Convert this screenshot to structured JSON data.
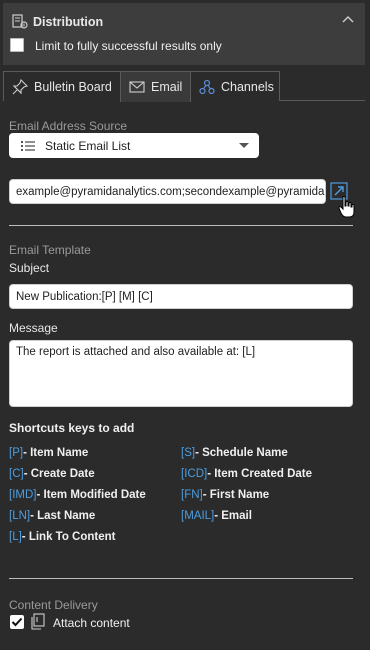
{
  "panel": {
    "title": "Distribution",
    "checkbox_label": "Limit to fully successful results only",
    "checkbox_checked": false
  },
  "tabs": [
    {
      "label": "Bulletin Board",
      "icon": "pin-icon",
      "active": false
    },
    {
      "label": "Email",
      "icon": "envelope-icon",
      "active": true
    },
    {
      "label": "Channels",
      "icon": "channels-icon",
      "active": false
    }
  ],
  "email_source": {
    "section_label": "Email Address Source",
    "selected": "Static Email List",
    "address_value": "example@pyramidanalytics.com;secondexample@pyramidanalytics.com"
  },
  "template": {
    "section_label": "Email Template",
    "subject_label": "Subject",
    "subject_value": "New Publication:[P] [M] [C]",
    "message_label": "Message",
    "message_value": "The report is attached and also available at: [L]"
  },
  "shortcuts": {
    "title": "Shortcuts keys to add",
    "items": [
      {
        "key": "[P]",
        "label": "- Item Name"
      },
      {
        "key": "[S]",
        "label": "- Schedule Name"
      },
      {
        "key": "[C]",
        "label": "- Create Date"
      },
      {
        "key": "[ICD]",
        "label": "- Item Created Date"
      },
      {
        "key": "[IMD]",
        "label": "- Item Modified Date"
      },
      {
        "key": "[FN]",
        "label": "- First Name"
      },
      {
        "key": "[LN]",
        "label": "- Last Name"
      },
      {
        "key": "[MAIL]",
        "label": "- Email"
      },
      {
        "key": "[L]",
        "label": "- Link To Content"
      }
    ]
  },
  "delivery": {
    "section_label": "Content Delivery",
    "attach_label": "Attach content",
    "attach_checked": true
  },
  "colors": {
    "accent": "#4d9de0",
    "background": "#2b2b2b",
    "header_bg": "#3d3d3d"
  }
}
